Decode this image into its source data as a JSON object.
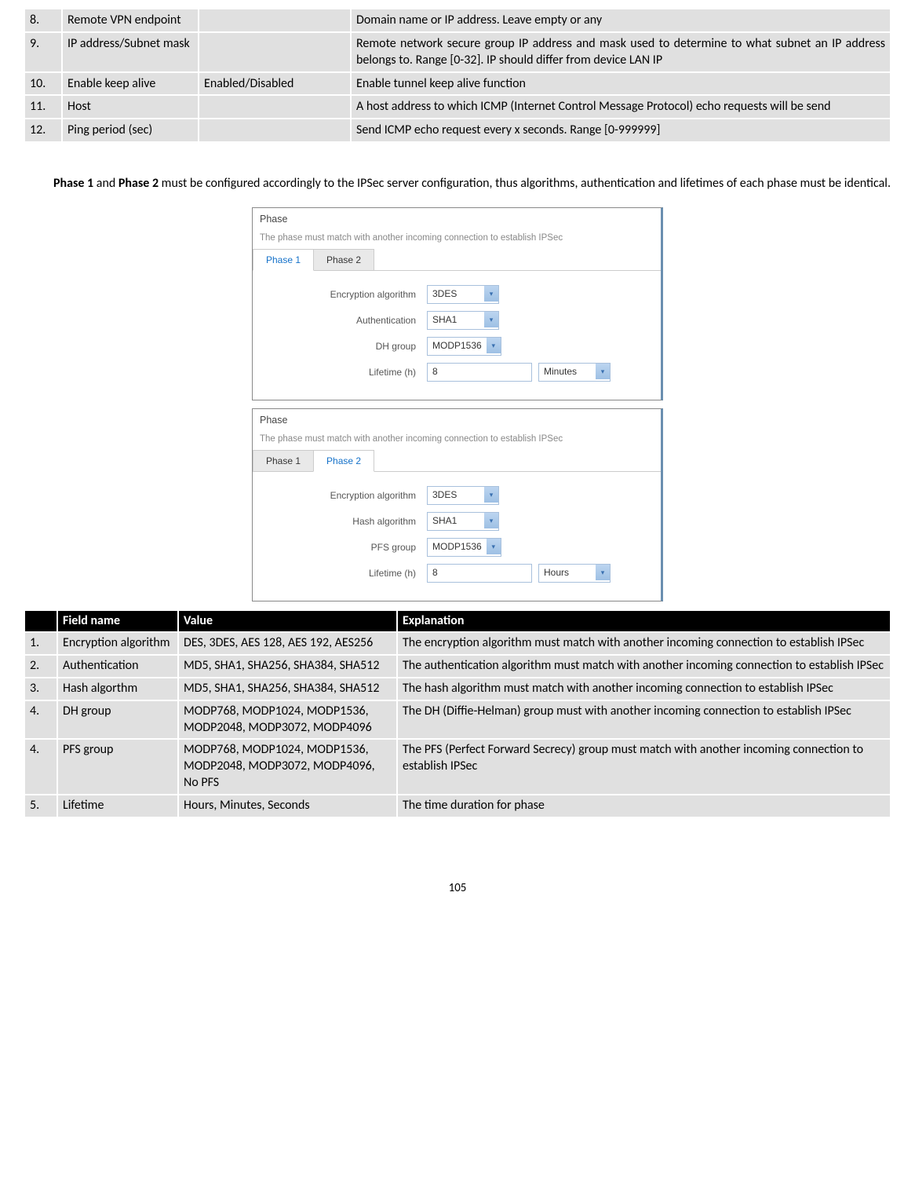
{
  "table1": {
    "rows": [
      {
        "n": "8.",
        "f": "Remote VPN endpoint",
        "v": "",
        "e": "Domain name or IP address. Leave empty or any"
      },
      {
        "n": "9.",
        "f": "IP address/Subnet mask",
        "v": "",
        "e": "Remote network secure group IP address and mask used to determine to what subnet an IP address belongs to. Range [0-32]. IP should differ from device LAN IP"
      },
      {
        "n": "10.",
        "f": "Enable keep alive",
        "v": "Enabled/Disabled",
        "e": "Enable tunnel keep alive function"
      },
      {
        "n": "11.",
        "f": "Host",
        "v": "",
        "e": "A host address to which ICMP (Internet Control Message Protocol) echo requests will be send"
      },
      {
        "n": "12.",
        "f": "Ping period (sec)",
        "v": "",
        "e": "Send ICMP echo request every x seconds.  Range [0-999999]"
      }
    ]
  },
  "paragraph": {
    "p1a": "Phase 1",
    "p1b": " and ",
    "p1c": "Phase 2",
    "p1d": " must be configured accordingly to the IPSec server configuration, thus algorithms, authentication and lifetimes of each phase must be identical."
  },
  "phase1": {
    "title": "Phase",
    "sub": "The phase must match with another incoming connection to establish IPSec",
    "tabA": "Phase 1",
    "tabB": "Phase 2",
    "f1": "Encryption algorithm",
    "v1": "3DES",
    "f2": "Authentication",
    "v2": "SHA1",
    "f3": "DH group",
    "v3": "MODP1536",
    "f4": "Lifetime (h)",
    "v4": "8",
    "u4": "Minutes"
  },
  "phase2": {
    "title": "Phase",
    "sub": "The phase must match with another incoming connection to establish IPSec",
    "tabA": "Phase 1",
    "tabB": "Phase 2",
    "f1": "Encryption algorithm",
    "v1": "3DES",
    "f2": "Hash algorithm",
    "v2": "SHA1",
    "f3": "PFS group",
    "v3": "MODP1536",
    "f4": "Lifetime (h)",
    "v4": "8",
    "u4": "Hours"
  },
  "table2": {
    "h1": "",
    "h2": "Field name",
    "h3": "Value",
    "h4": "Explanation",
    "rows": [
      {
        "n": "1.",
        "f": "Encryption algorithm",
        "v": "DES, 3DES, AES 128, AES 192, AES256",
        "e": "The encryption algorithm must match with another incoming connection to establish IPSec",
        "j": true
      },
      {
        "n": "2.",
        "f": "Authentication",
        "v": "MD5, SHA1, SHA256, SHA384, SHA512",
        "e": "The authentication algorithm must match with another incoming connection to establish IPSec",
        "j": true
      },
      {
        "n": "3.",
        "f": "Hash algorthm",
        "v": "MD5, SHA1, SHA256, SHA384, SHA512",
        "e": "The hash algorithm must match with another incoming connection to establish IPSec",
        "j": true
      },
      {
        "n": "4.",
        "f": "DH group",
        "v": "MODP768,  MODP1024, MODP1536, MODP2048, MODP3072, MODP4096",
        "e": "The DH (Diffie-Helman) group must with another incoming connection to establish IPSec",
        "j": true
      },
      {
        "n": "4.",
        "f": "PFS group",
        "v": "MODP768,  MODP1024, MODP1536, MODP2048, MODP3072, MODP4096, No PFS",
        "e": "The PFS (Perfect Forward Secrecy) group must match with another incoming connection to establish IPSec"
      },
      {
        "n": "5.",
        "f": "Lifetime",
        "v": "Hours, Minutes, Seconds",
        "e": "The time duration for phase"
      }
    ]
  },
  "pagenum": "105"
}
